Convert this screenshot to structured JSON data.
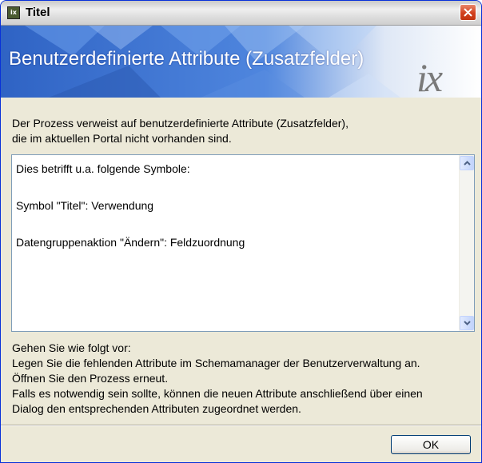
{
  "window": {
    "title": "Titel",
    "app_icon_text": "ix"
  },
  "banner": {
    "title": "Benutzerdefinierte Attribute (Zusatzfelder)",
    "logo_text": "ix"
  },
  "intro": {
    "lines": [
      "Der Prozess verweist auf benutzerdefinierte Attribute (Zusatzfelder),",
      "die im aktuellen Portal nicht vorhanden sind."
    ]
  },
  "details": {
    "lines": [
      "Dies betrifft u.a. folgende Symbole:",
      "",
      "Symbol \"Titel\": Verwendung",
      "",
      "Datengruppenaktion \"Ändern\": Feldzuordnung"
    ]
  },
  "instructions": {
    "lines": [
      "Gehen Sie wie folgt vor:",
      "Legen Sie die fehlenden Attribute im Schemamanager der Benutzerverwaltung an.",
      "Öffnen Sie den Prozess erneut.",
      "Falls es notwendig sein sollte, können die neuen Attribute anschließend über einen",
      "Dialog den entsprechenden Attributen zugeordnet werden."
    ]
  },
  "buttons": {
    "ok_label": "OK"
  },
  "colors": {
    "banner_blue": "#3569c8",
    "close_red": "#d1401d"
  }
}
